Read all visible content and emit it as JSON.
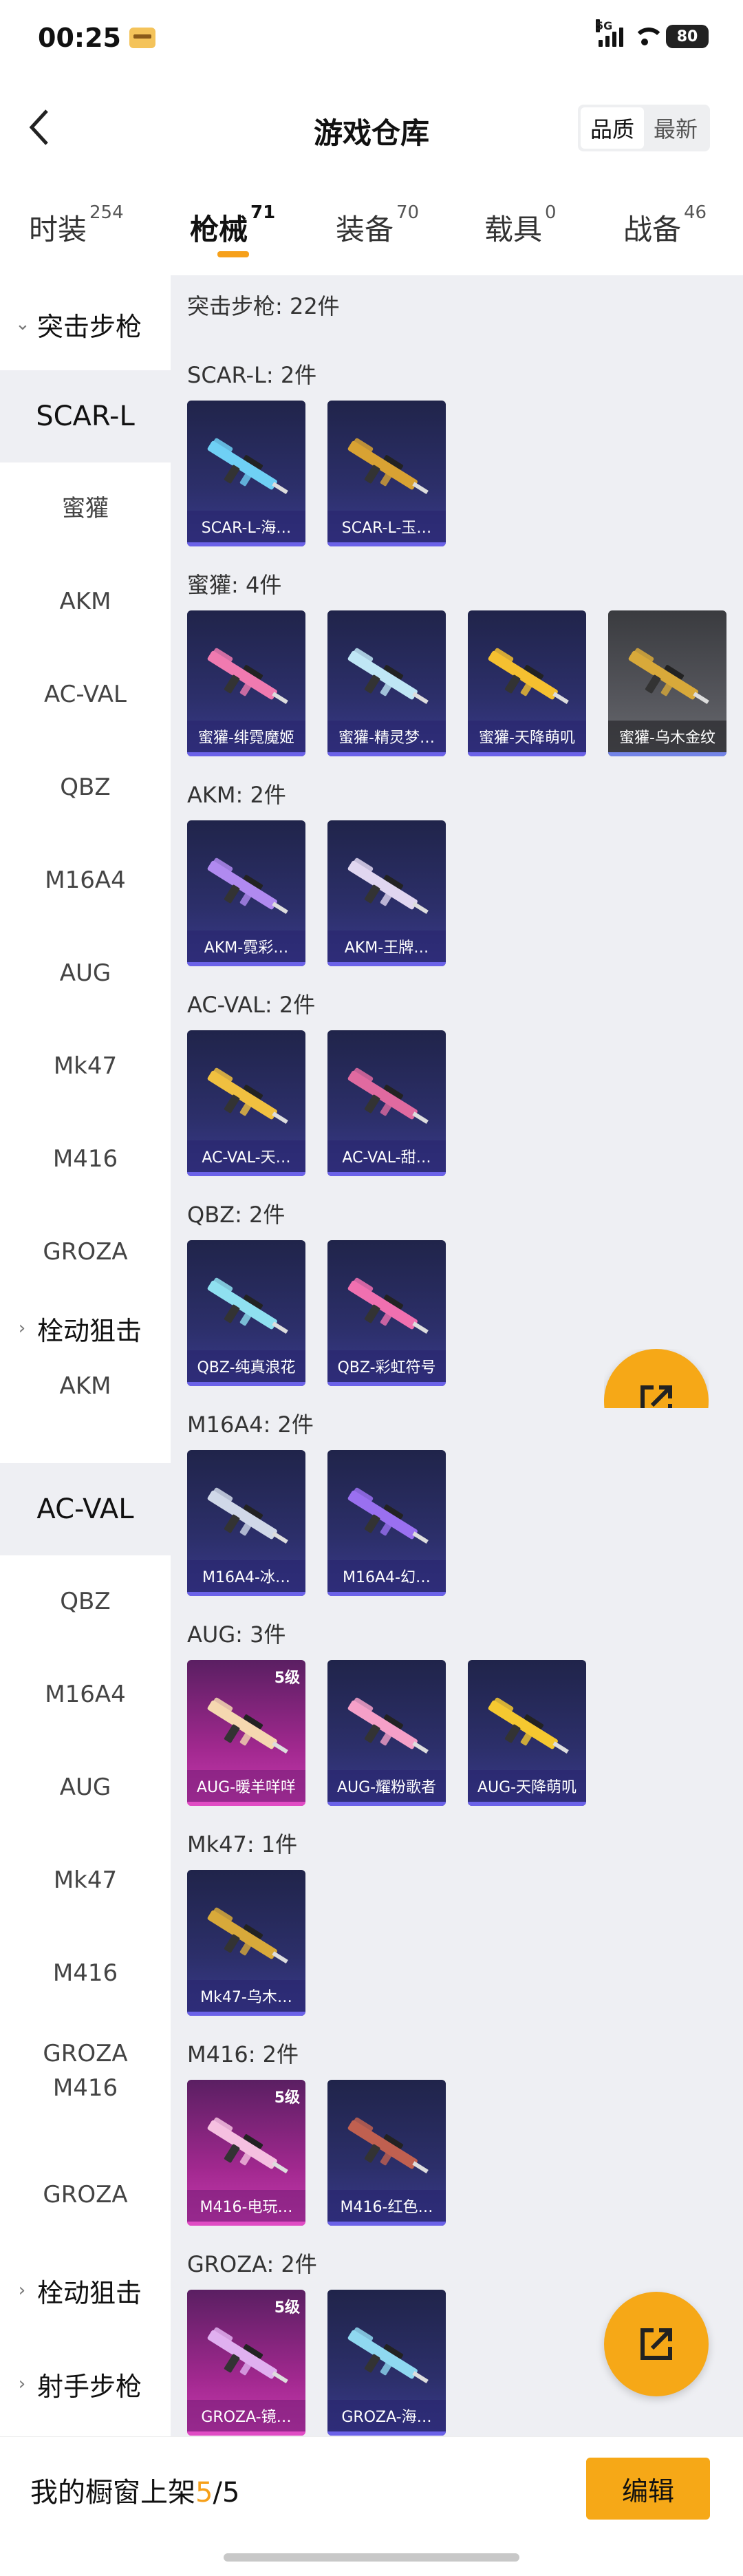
{
  "status_bar": {
    "time": "00:25",
    "network": "5G",
    "battery": "80"
  },
  "header": {
    "back_icon": "chevron-left-icon",
    "title": "游戏仓库",
    "sort_options": [
      "品质",
      "最新"
    ],
    "sort_active": "品质"
  },
  "tabs": [
    {
      "label": "时装",
      "count": "254"
    },
    {
      "label": "枪械",
      "count": "71",
      "active": true
    },
    {
      "label": "装备",
      "count": "70"
    },
    {
      "label": "载具",
      "count": "0"
    },
    {
      "label": "战备",
      "count": "46"
    }
  ],
  "sidebar": {
    "group_assault": "突击步枪",
    "assault_items": [
      "SCAR-L",
      "蜜獾",
      "AKM",
      "AC-VAL",
      "QBZ",
      "M16A4",
      "AUG",
      "Mk47",
      "M416",
      "GROZA"
    ],
    "group_bolt": "栓动狙击",
    "extra_items": [
      "AKM",
      "AC-VAL",
      "QBZ",
      "M16A4",
      "AUG",
      "Mk47",
      "M416",
      "GROZA",
      "M416",
      "GROZA"
    ],
    "group_bolt2": "栓动狙击",
    "group_dmr": "射手步枪",
    "active_item": "SCAR-L",
    "active_item2": "AC-VAL"
  },
  "content": {
    "total_label": "突击步枪: 22件",
    "sections": [
      {
        "label": "SCAR-L: 2件",
        "items": [
          {
            "name": "SCAR-L-海…",
            "style": "blue",
            "gun_color": "#6fd0f5"
          },
          {
            "name": "SCAR-L-玉…",
            "style": "blue",
            "gun_color": "#d8a233"
          }
        ]
      },
      {
        "label": "蜜獾: 4件",
        "items": [
          {
            "name": "蜜獾-绯霓魔姬",
            "style": "blue",
            "gun_color": "#f07ab0"
          },
          {
            "name": "蜜獾-精灵梦…",
            "style": "blue",
            "gun_color": "#bfe6f5"
          },
          {
            "name": "蜜獾-天降萌叽",
            "style": "blue",
            "gun_color": "#f5c030"
          },
          {
            "name": "蜜獾-乌木金纹",
            "style": "gray",
            "gun_color": "#d8a93a"
          }
        ]
      },
      {
        "label": "AKM: 2件",
        "items": [
          {
            "name": "AKM-霓彩…",
            "style": "blue",
            "gun_color": "#b08af0"
          },
          {
            "name": "AKM-王牌…",
            "style": "blue",
            "gun_color": "#e0d6f0"
          }
        ]
      },
      {
        "label": "AC-VAL: 2件",
        "items": [
          {
            "name": "AC-VAL-天…",
            "style": "blue",
            "gun_color": "#f0c040"
          },
          {
            "name": "AC-VAL-甜…",
            "style": "blue",
            "gun_color": "#e06aa0"
          }
        ]
      },
      {
        "label": "QBZ: 2件",
        "items": [
          {
            "name": "QBZ-纯真浪花",
            "style": "blue",
            "gun_color": "#8fe0f0"
          },
          {
            "name": "QBZ-彩虹符号",
            "style": "blue",
            "gun_color": "#f070b0"
          }
        ]
      },
      {
        "label": "M16A4: 2件",
        "items": [
          {
            "name": "M16A4-冰…",
            "style": "blue",
            "gun_color": "#d0d8e8"
          },
          {
            "name": "M16A4-幻…",
            "style": "blue",
            "gun_color": "#9a70f0"
          }
        ]
      },
      {
        "label": "AUG: 3件",
        "items": [
          {
            "name": "AUG-暖羊咩咩",
            "style": "pink",
            "grade": "5级",
            "gun_color": "#f5d8b0"
          },
          {
            "name": "AUG-耀粉歌者",
            "style": "blue",
            "gun_color": "#f5a0c8"
          },
          {
            "name": "AUG-天降萌叽",
            "style": "blue",
            "gun_color": "#f5c830"
          }
        ]
      },
      {
        "label": "Mk47: 1件",
        "items": [
          {
            "name": "Mk47-乌木…",
            "style": "blue",
            "gun_color": "#d8a93a"
          }
        ]
      },
      {
        "label": "M416: 2件",
        "items": [
          {
            "name": "M416-电玩…",
            "style": "pink",
            "grade": "5级",
            "gun_color": "#f5c0e0"
          },
          {
            "name": "M416-红色…",
            "style": "blue",
            "gun_color": "#c06050"
          }
        ]
      },
      {
        "label": "GROZA: 2件",
        "items": [
          {
            "name": "GROZA-镜…",
            "style": "pink",
            "grade": "5级",
            "gun_color": "#e0b0f0"
          },
          {
            "name": "GROZA-海…",
            "style": "blue",
            "gun_color": "#8fd8f0"
          }
        ]
      }
    ]
  },
  "fab": {
    "icon": "share-external-icon",
    "color": "#f6a817"
  },
  "footer": {
    "text": "我的橱窗上架",
    "count": "5",
    "separator": "/",
    "total": "5",
    "edit_label": "编辑"
  },
  "colors": {
    "accent": "#f6a817",
    "sidebar_active_bg": "#eeeff3"
  }
}
